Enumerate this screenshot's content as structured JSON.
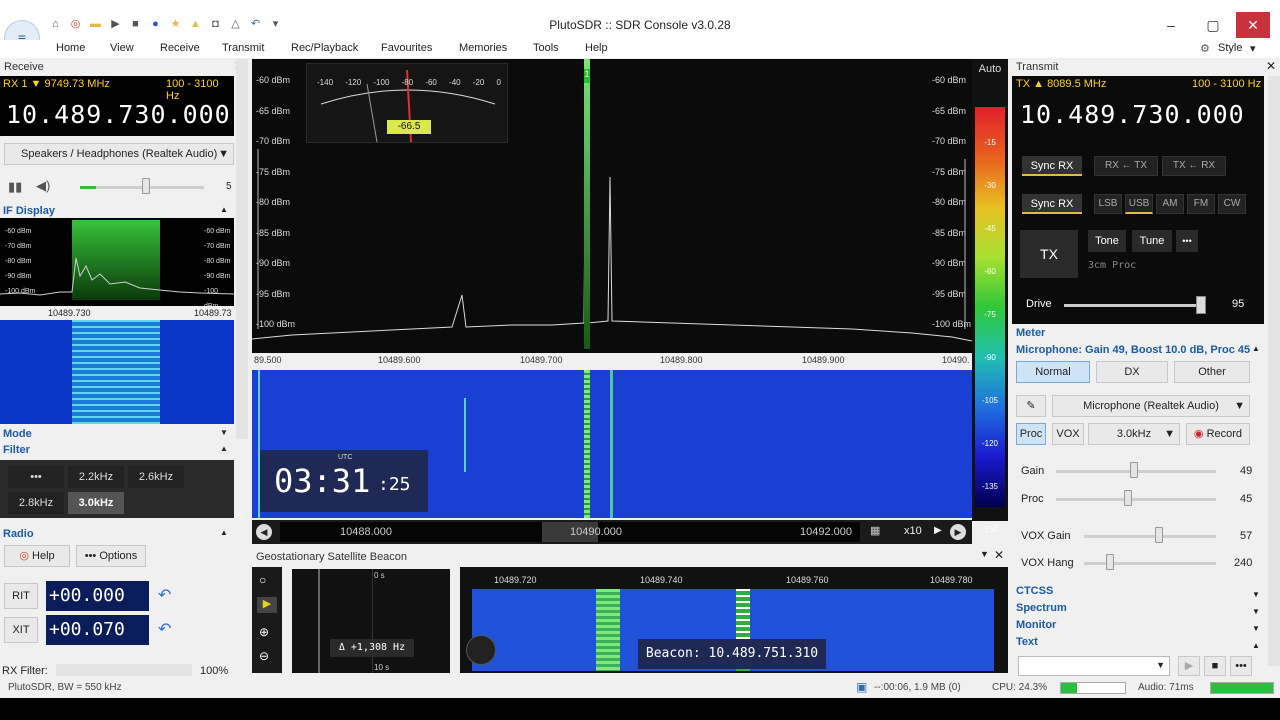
{
  "app": {
    "title": "PlutoSDR :: SDR Console v3.0.28"
  },
  "menu": [
    "Home",
    "View",
    "Receive",
    "Transmit",
    "Rec/Playback",
    "Favourites",
    "Memories",
    "Tools",
    "Help"
  ],
  "style_label": "Style",
  "receive": {
    "panel_title": "Receive",
    "rx_label": "RX 1",
    "rx_freq": "9749.73 MHz",
    "bandwidth": "100 - 3100 Hz",
    "frequency": "10.489.730.000",
    "audio_device": "Speakers / Headphones (Realtek Audio)",
    "volume_value": "5",
    "if_display": "IF Display",
    "if_dbm": [
      "-60 dBm",
      "-70 dBm",
      "-80 dBm",
      "-90 dBm",
      "-100 dBm"
    ],
    "if_freq_left": "10489.730",
    "if_freq_right": "10489.73",
    "mode": "Mode",
    "filter": "Filter",
    "filters": [
      "•••",
      "2.2kHz",
      "2.6kHz",
      "2.8kHz",
      "3.0kHz"
    ],
    "radio": "Radio",
    "help": "Help",
    "options": "••• Options",
    "rit_label": "RIT",
    "rit_value": "+00.000",
    "xit_label": "XIT",
    "xit_value": "+00.070",
    "rx_filter": "RX Filter:",
    "rx_filter_pct": "100%"
  },
  "spectrum": {
    "auto": "Auto",
    "dbm_left": [
      "-60 dBm",
      "-65 dBm",
      "-70 dBm",
      "-75 dBm",
      "-80 dBm",
      "-85 dBm",
      "-90 dBm",
      "-95 dBm",
      "-100 dBm"
    ],
    "dbm_right": [
      "-60 dBm",
      "-65 dBm",
      "-70 dBm",
      "-75 dBm",
      "-80 dBm",
      "-85 dBm",
      "-90 dBm",
      "-95 dBm",
      "-100 dBm"
    ],
    "x_labels": [
      "89.500",
      "10489.600",
      "10489.700",
      "10489.800",
      "10489.900",
      "10490."
    ],
    "meter_scale": [
      "-140",
      "-120",
      "-100",
      "-80",
      "-60",
      "-40",
      "-20",
      "0"
    ],
    "meter_value": "-66.5",
    "marker": "1",
    "colorbar": [
      "-15",
      "-30",
      "-45",
      "-60",
      "-75",
      "-90",
      "-105",
      "-120",
      "-135",
      "-150"
    ],
    "clock_utc": "UTC",
    "clock_hm": "03:31",
    "clock_s": ":25",
    "overview": [
      "10488.000",
      "10490.000",
      "10492.000"
    ],
    "zoom": "x10"
  },
  "beacon": {
    "title": "Geostationary Satellite Beacon",
    "time_top": "0 s",
    "time_bottom": "10 s",
    "delta": "Δ +1,308 Hz",
    "x_labels": [
      "10489.720",
      "10489.740",
      "10489.760",
      "10489.780"
    ],
    "readout": "Beacon: 10.489.751.310"
  },
  "transmit": {
    "panel_title": "Transmit",
    "tx_label": "TX",
    "tx_freq": "8089.5 MHz",
    "bandwidth": "100 - 3100 Hz",
    "frequency": "10.489.730.000",
    "sync_rx": "Sync RX",
    "rx_to_tx": "RX ← TX",
    "tx_to_rx": "TX ← RX",
    "modes": [
      "LSB",
      "USB",
      "AM",
      "FM",
      "CW"
    ],
    "tx": "TX",
    "tone": "Tone",
    "tune": "Tune",
    "more": "•••",
    "proc_note": "3cm Proc",
    "drive_label": "Drive",
    "drive_value": "95",
    "drive_level": 0.95,
    "meter": "Meter",
    "mic_info": "Microphone: Gain 49, Boost 10.0 dB, Proc 45",
    "tabs": [
      "Normal",
      "DX",
      "Other"
    ],
    "mic_device": "Microphone (Realtek Audio)",
    "proc": "Proc",
    "vox": "VOX",
    "bw": "3.0kHz",
    "record": "Record",
    "sliders": [
      {
        "label": "Gain",
        "value": "49",
        "level": 0.49
      },
      {
        "label": "Proc",
        "value": "45",
        "level": 0.45
      },
      {
        "label": "VOX Gain",
        "value": "57",
        "level": 0.57
      },
      {
        "label": "VOX Hang",
        "value": "240",
        "level": 0.2
      }
    ],
    "sections": [
      "CTCSS",
      "Spectrum",
      "Monitor",
      "Text"
    ]
  },
  "status": {
    "left": "PlutoSDR, BW = 550 kHz",
    "time": "--:00:06, 1.9 MB (0)",
    "cpu": "CPU: 24.3%",
    "audio": "Audio: 71ms"
  },
  "colors": {
    "accent": "#1c5aa6",
    "spectrum_bg": "#0b0b0b",
    "waterfall": "#1a3fd4",
    "marker": "#22c02a"
  }
}
